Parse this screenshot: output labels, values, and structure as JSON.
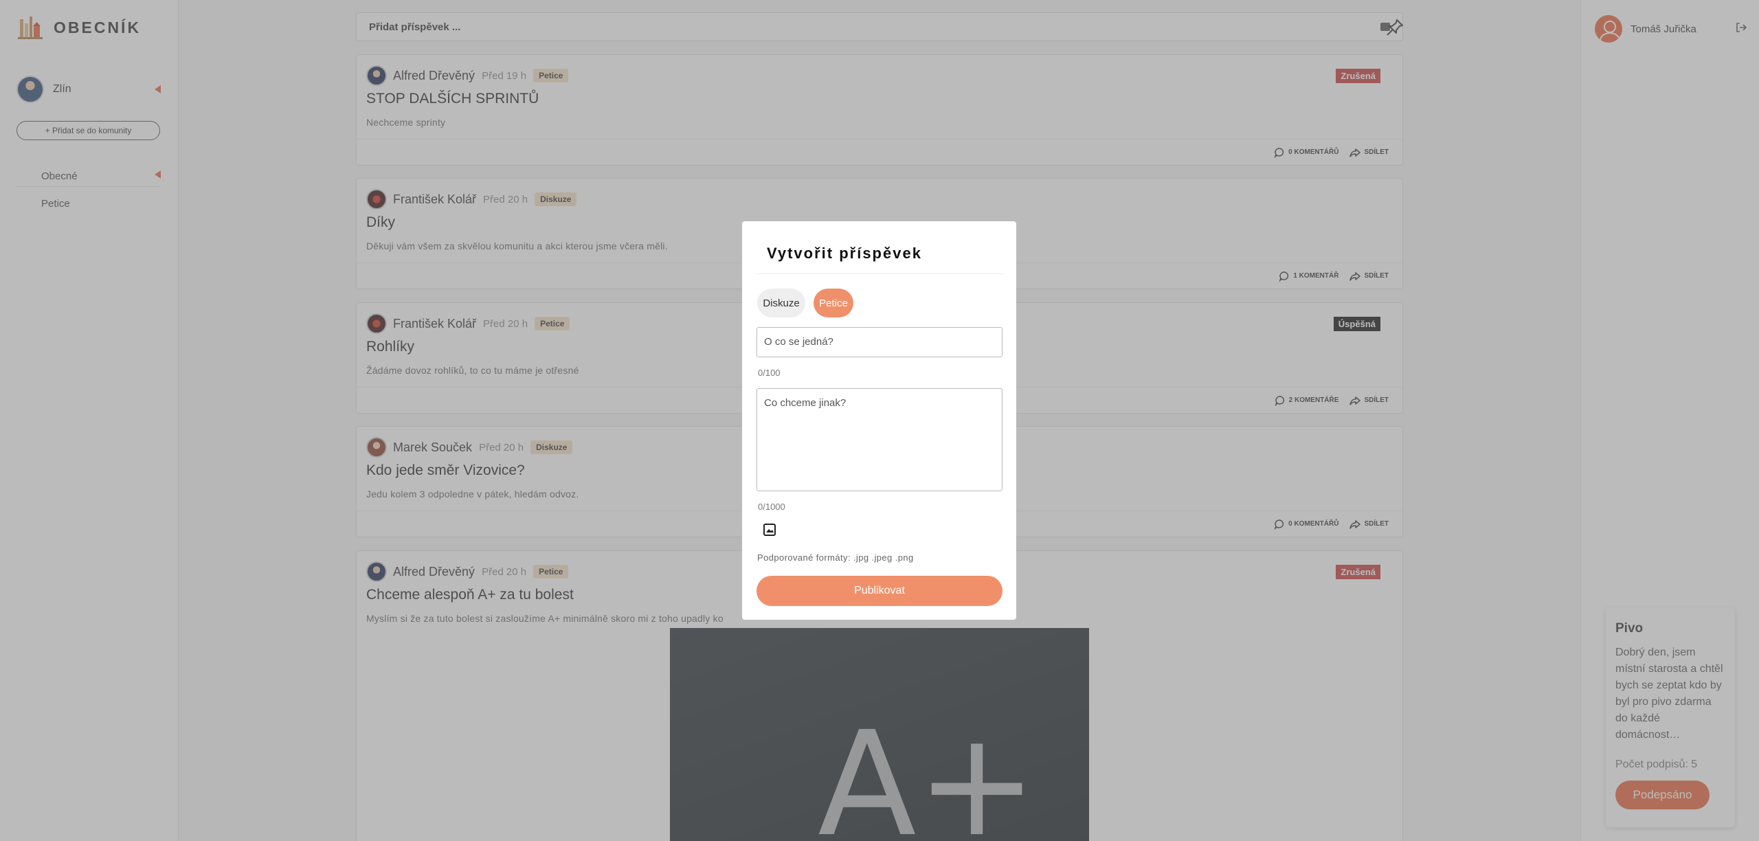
{
  "app": {
    "logo_text": "OBECNÍK"
  },
  "sidebar": {
    "community_name": "Zlín",
    "join_label": "+ Přidat se do komunity",
    "nav": [
      {
        "label": "Obecné"
      },
      {
        "label": "Petice"
      }
    ]
  },
  "feed": {
    "search_placeholder": "Přidat příspěvek ...",
    "posts": [
      {
        "author": "Alfred Dřevěný",
        "time": "Před 19 h",
        "tag": "Petice",
        "status": "Zrušená",
        "title": "STOP DALŠÍCH SPRINTŮ",
        "body": "Nechceme sprinty",
        "comments": "0 KOMENTÁŘŮ",
        "share": "SDÍLET"
      },
      {
        "author": "František Kolář",
        "time": "Před 20 h",
        "tag": "Diskuze",
        "status": "",
        "title": "Díky",
        "body": "Děkuji vám všem za skvělou komunitu a akci kterou jsme včera měli.",
        "comments": "1 KOMENTÁŘ",
        "share": "SDÍLET"
      },
      {
        "author": "František Kolář",
        "time": "Před 20 h",
        "tag": "Petice",
        "status": "Úspěšná",
        "title": "Rohlíky",
        "body": "Žádáme dovoz rohlíků, to co tu máme je otřesné",
        "comments": "2 KOMENTÁŘE",
        "share": "SDÍLET"
      },
      {
        "author": "Marek Souček",
        "time": "Před 20 h",
        "tag": "Diskuze",
        "status": "",
        "title": "Kdo jede směr Vizovice?",
        "body": "Jedu kolem 3 odpoledne v pátek, hledám odvoz.",
        "comments": "0 KOMENTÁŘŮ",
        "share": "SDÍLET"
      },
      {
        "author": "Alfred Dřevěný",
        "time": "Před 20 h",
        "tag": "Petice",
        "status": "Zrušená",
        "title": "Chceme alespoň A+ za tu bolest",
        "body": "Myslím si že za tuto bolest si zasloužíme A+ minimálně skoro mi z toho upadly ko",
        "image_text": "A+"
      }
    ]
  },
  "right": {
    "user_name": "Tomáš Juřička",
    "petition": {
      "title": "Pivo",
      "text": "Dobrý den, jsem místní starosta a chtěl bych se zeptat kdo by byl pro pivo zdarma do každé domácnost…",
      "signatures": "Počet podpisů: 5",
      "button": "Podepsáno"
    }
  },
  "modal": {
    "title": "Vytvořit příspěvek",
    "type_discussion": "Diskuze",
    "type_petition": "Petice",
    "title_placeholder": "O co se jedná?",
    "title_counter": "0/100",
    "body_placeholder": "Co chceme jinak?",
    "body_counter": "0/1000",
    "formats": "Podporované formáty: .jpg .jpeg .png",
    "publish": "Publikovat"
  },
  "colors": {
    "accent": "#e8643c",
    "accent_light": "#f0906a",
    "cancelled": "#c93a3a",
    "success": "#111111",
    "tag_bg": "#f5e0c4"
  }
}
